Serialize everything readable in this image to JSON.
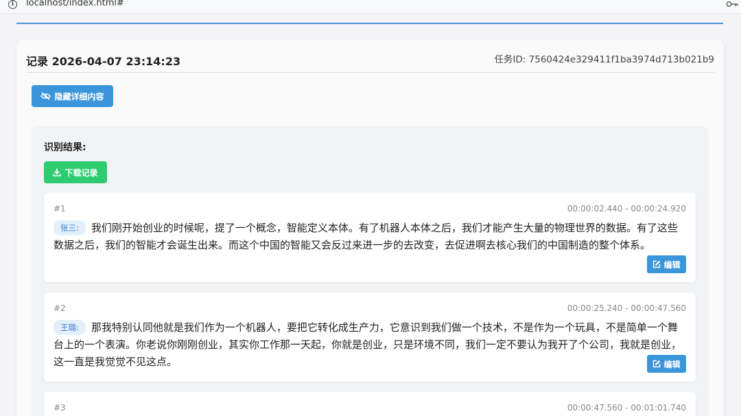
{
  "browser": {
    "url": "localhost/index.html#",
    "info_icon": "info-icon",
    "key_icon": "key-icon"
  },
  "record": {
    "title": "记录 2026-04-07 23:14:23",
    "task_id": "任务ID: 7560424e329411f1ba3974d713b021b9",
    "hide_button_label": "隐藏详细内容",
    "hide_button_icon": "eye-slash-icon"
  },
  "results": {
    "label": "识别结果:",
    "download_label": "下载记录",
    "download_icon": "download-icon",
    "edit_label": "编辑",
    "edit_icon": "edit-icon",
    "segments": [
      {
        "index": "#1",
        "time": "00:00:02.440 - 00:00:24.920",
        "speaker": "张三:",
        "text": "我们刚开始创业的时候呢，提了一个概念，智能定义本体。有了机器人本体之后，我们才能产生大量的物理世界的数据。有了这些数据之后，我们的智能才会诞生出来。而这个中国的智能又会反过来进一步的去改变，去促进啊去核心我们的中国制造的整个体系。"
      },
      {
        "index": "#2",
        "time": "00:00:25.240 - 00:00:47.560",
        "speaker": "王璐:",
        "text": "那我特别认同他就是我们作为一个机器人，要把它转化成生产力，它意识到我们做一个技术，不是作为一个玩具，不是简单一个舞台上的一个表演。你老说你刚刚创业，其实你工作那一天起，你就是创业，只是环境不同，我们一定不要认为我开了个公司，我就是创业，这一直是我觉觉不见这点。"
      },
      {
        "index": "#3",
        "time": "00:00:47.560 - 00:01:01.740"
      }
    ]
  },
  "colors": {
    "primary_blue": "#3b95db",
    "success_green": "#2ecc71",
    "speaker_bg": "#e3effb"
  }
}
